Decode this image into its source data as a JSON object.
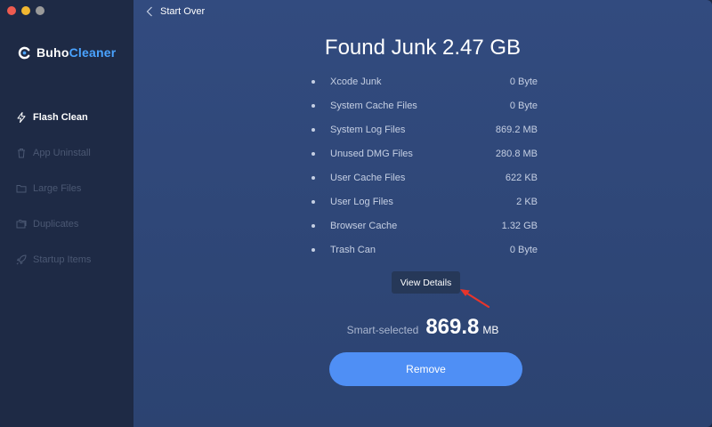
{
  "app": {
    "name_part1": "Buho",
    "name_part2": "Cleaner",
    "accent_color": "#4aa3ff"
  },
  "sidebar": {
    "items": [
      {
        "label": "Flash Clean",
        "icon": "lightning-icon",
        "active": true
      },
      {
        "label": "App Uninstall",
        "icon": "trash-icon",
        "active": false
      },
      {
        "label": "Large Files",
        "icon": "folder-icon",
        "active": false
      },
      {
        "label": "Duplicates",
        "icon": "duplicate-folder-icon",
        "active": false
      },
      {
        "label": "Startup Items",
        "icon": "rocket-icon",
        "active": false
      }
    ]
  },
  "header": {
    "back_label": "Start Over"
  },
  "main": {
    "title": "Found Junk 2.47 GB",
    "junk_items": [
      {
        "name": "Xcode Junk",
        "size": "0 Byte"
      },
      {
        "name": "System Cache Files",
        "size": "0 Byte"
      },
      {
        "name": "System Log Files",
        "size": "869.2 MB"
      },
      {
        "name": "Unused DMG Files",
        "size": "280.8 MB"
      },
      {
        "name": "User Cache Files",
        "size": "622 KB"
      },
      {
        "name": "User Log Files",
        "size": "2 KB"
      },
      {
        "name": "Browser Cache",
        "size": "1.32 GB"
      },
      {
        "name": "Trash Can",
        "size": "0 Byte"
      }
    ],
    "view_details_label": "View Details",
    "smart_selected_label": "Smart-selected",
    "smart_selected_value": "869.8",
    "smart_selected_unit": "MB",
    "remove_label": "Remove",
    "remove_color": "#4f8ff5"
  }
}
